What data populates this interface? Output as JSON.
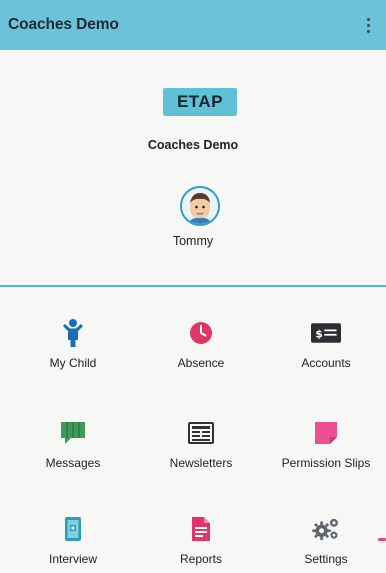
{
  "appbar": {
    "title": "Coaches Demo",
    "menu_icon": "overflow-menu-icon"
  },
  "header": {
    "logo_text": "ETAP",
    "school_name": "Coaches Demo",
    "child_name": "Tommy",
    "avatar_icon": "child-avatar"
  },
  "menu": {
    "items": [
      {
        "label": "My Child",
        "icon": "child-icon",
        "color": "#1a6fb3"
      },
      {
        "label": "Absence",
        "icon": "clock-icon",
        "color": "#e0356a"
      },
      {
        "label": "Accounts",
        "icon": "money-icon",
        "color": "#2b2f33"
      },
      {
        "label": "Messages",
        "icon": "chat-icon",
        "color": "#3e9a57"
      },
      {
        "label": "Newsletters",
        "icon": "newspaper-icon",
        "color": "#333333"
      },
      {
        "label": "Permission Slips",
        "icon": "sticky-note-icon",
        "color": "#ee4f92"
      },
      {
        "label": "Interview",
        "icon": "calendar-icon",
        "color": "#2aa0b8"
      },
      {
        "label": "Reports",
        "icon": "document-icon",
        "color": "#e0356a"
      },
      {
        "label": "Settings",
        "icon": "gears-icon",
        "color": "#5d666d"
      }
    ]
  },
  "colors": {
    "appbar": "#6cc3d9",
    "divider": "#4fb7d1",
    "background": "#f7f7f5"
  }
}
